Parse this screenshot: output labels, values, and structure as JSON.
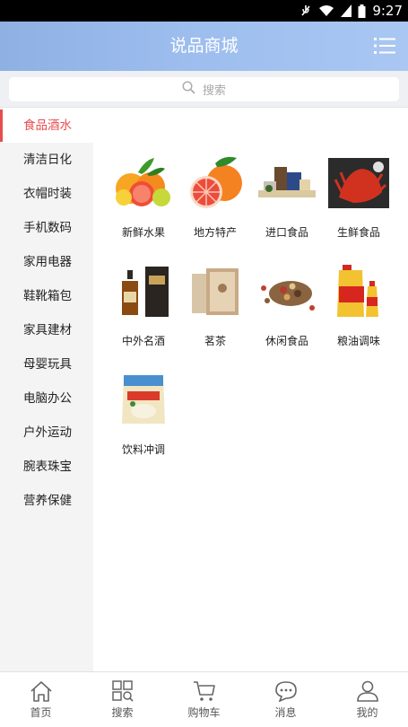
{
  "status_bar": {
    "time": "9:27"
  },
  "header": {
    "title": "说品商城",
    "menu_icon": "list-menu-icon"
  },
  "search": {
    "placeholder": "搜索"
  },
  "sidebar": {
    "items": [
      {
        "label": "食品酒水",
        "active": true
      },
      {
        "label": "清洁日化"
      },
      {
        "label": "衣帽时装"
      },
      {
        "label": "手机数码"
      },
      {
        "label": "家用电器"
      },
      {
        "label": "鞋靴箱包"
      },
      {
        "label": "家具建材"
      },
      {
        "label": "母婴玩具"
      },
      {
        "label": "电脑办公"
      },
      {
        "label": "户外运动"
      },
      {
        "label": "腕表珠宝"
      },
      {
        "label": "营养保健"
      }
    ]
  },
  "categories": [
    {
      "label": "新鲜水果",
      "icon": "fruit-icon"
    },
    {
      "label": "地方特产",
      "icon": "grapefruit-icon"
    },
    {
      "label": "进口食品",
      "icon": "imported-food-icon"
    },
    {
      "label": "生鲜食品",
      "icon": "seafood-icon"
    },
    {
      "label": "中外名酒",
      "icon": "liquor-icon"
    },
    {
      "label": "茗茶",
      "icon": "tea-box-icon"
    },
    {
      "label": "休闲食品",
      "icon": "snacks-icon"
    },
    {
      "label": "粮油调味",
      "icon": "cooking-oil-icon"
    },
    {
      "label": "饮料冲调",
      "icon": "drink-powder-icon"
    }
  ],
  "tabbar": {
    "items": [
      {
        "label": "首页",
        "icon": "home-icon"
      },
      {
        "label": "搜索",
        "icon": "grid-search-icon"
      },
      {
        "label": "购物车",
        "icon": "cart-icon"
      },
      {
        "label": "消息",
        "icon": "chat-icon"
      },
      {
        "label": "我的",
        "icon": "user-icon"
      }
    ]
  },
  "colors": {
    "accent": "#e84c4f",
    "header": "#9cbdee",
    "sidebar_bg": "#f4f4f4"
  }
}
